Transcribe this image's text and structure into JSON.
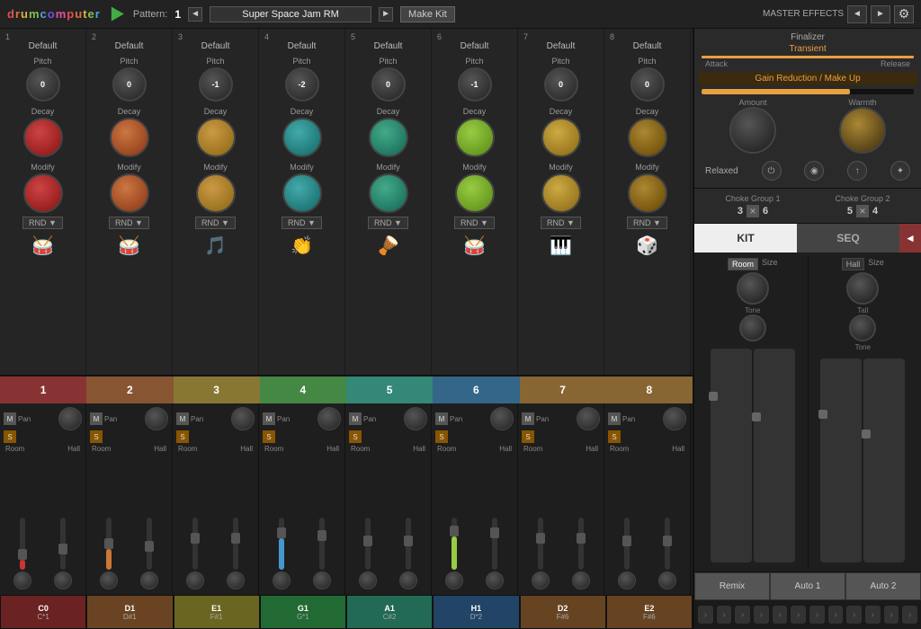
{
  "app": {
    "title": "drumcomputer",
    "title_parts": [
      "d",
      "r",
      "u",
      "m",
      "c",
      "o",
      "m",
      "p",
      "u",
      "t",
      "e",
      "r"
    ]
  },
  "top_bar": {
    "pattern_label": "Pattern:",
    "pattern_num": "1",
    "preset_name": "Super Space Jam RM",
    "make_kit": "Make Kit",
    "master_effects": "MASTER EFFECTS",
    "settings_icon": "⚙"
  },
  "channels": [
    {
      "num": "1",
      "name": "Default",
      "pitch_val": "0",
      "decay_color": "red",
      "modify_color": "red",
      "rnd": "RND",
      "drum_icon": "🥁",
      "btn_label": "1",
      "note1": "C0",
      "note2": "C*1"
    },
    {
      "num": "2",
      "name": "Default",
      "pitch_val": "0",
      "decay_color": "orange",
      "modify_color": "orange",
      "rnd": "RND",
      "drum_icon": "🥁",
      "btn_label": "2",
      "note1": "D1",
      "note2": "D#1"
    },
    {
      "num": "3",
      "name": "Default",
      "pitch_val": "-1",
      "decay_color": "yellow-orange",
      "modify_color": "yellow-orange",
      "rnd": "RND",
      "drum_icon": "🎵",
      "btn_label": "3",
      "note1": "E1",
      "note2": "F#1"
    },
    {
      "num": "4",
      "name": "Default",
      "pitch_val": "-2",
      "decay_color": "teal",
      "modify_color": "teal",
      "rnd": "RND",
      "drum_icon": "👏",
      "btn_label": "4",
      "note1": "G1",
      "note2": "G*1"
    },
    {
      "num": "5",
      "name": "Default",
      "pitch_val": "0",
      "decay_color": "green-teal",
      "modify_color": "green-teal",
      "rnd": "RND",
      "drum_icon": "🪘",
      "btn_label": "5",
      "note1": "A1",
      "note2": "C#2"
    },
    {
      "num": "6",
      "name": "Default",
      "pitch_val": "-1",
      "decay_color": "yellow-green",
      "modify_color": "yellow-green",
      "rnd": "RND",
      "drum_icon": "🥁",
      "btn_label": "6",
      "note1": "H1",
      "note2": "D*2"
    },
    {
      "num": "7",
      "name": "Default",
      "pitch_val": "0",
      "decay_color": "gold",
      "modify_color": "gold",
      "rnd": "RND",
      "drum_icon": "🎹",
      "btn_label": "7",
      "note1": "D2",
      "note2": "F#6"
    },
    {
      "num": "8",
      "name": "Default",
      "pitch_val": "0",
      "decay_color": "dark-gold",
      "modify_color": "dark-gold",
      "rnd": "RND",
      "drum_icon": "🎲",
      "btn_label": "8",
      "note1": "E2",
      "note2": "F#6"
    }
  ],
  "right_panel": {
    "master_effects": "MASTER EFFECTS",
    "finalizer": "Finalizer",
    "transient": "Transient",
    "attack": "Attack",
    "release": "Release",
    "gain_reduction": "Gain Reduction / Make Up",
    "amount": "Amount",
    "warmth": "Warmth",
    "relaxed": "Relaxed",
    "choke_group_1": "Choke Group 1",
    "choke_group_2": "Choke Group 2",
    "choke1_vals": [
      "3",
      "6"
    ],
    "choke2_vals": [
      "5",
      "4"
    ],
    "kit": "KIT",
    "seq": "SEQ",
    "room": "Room",
    "hall": "Hall",
    "size1": "Size",
    "size2": "Size",
    "tone": "Tone",
    "tall": "Tall",
    "tone2": "Tone",
    "remix": "Remix",
    "auto1": "Auto 1",
    "auto2": "Auto 2"
  },
  "seq_arrows": [
    "›",
    "›",
    "›",
    "›",
    "›",
    "›",
    "›",
    "›",
    "›",
    "›",
    "›",
    "›",
    "›",
    "›",
    "›",
    "›"
  ]
}
